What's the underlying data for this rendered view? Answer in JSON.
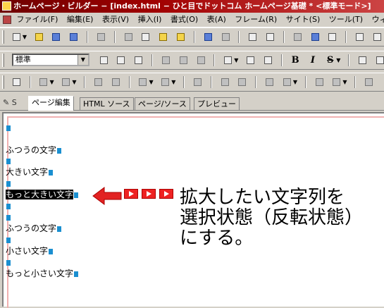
{
  "window": {
    "title": "ホームページ・ビルダー − [index.html − ひと目でドットコム ホームページ基礎 * <標準モード>]"
  },
  "menubar": {
    "items": [
      "ファイル(F)",
      "編集(E)",
      "表示(V)",
      "挿入(I)",
      "書式(O)",
      "表(A)",
      "フレーム(R)",
      "サイト(S)",
      "ツール(T)",
      "ウィ"
    ]
  },
  "format_toolbar": {
    "style_select_value": "標準",
    "bold": "B",
    "italic": "I",
    "strike": "S"
  },
  "tabs": {
    "items": [
      "ページ編集",
      "HTML ソース",
      "ページ/ソース",
      "プレビュー"
    ],
    "active": "ページ編集"
  },
  "document": {
    "lines": [
      "ふつうの文字",
      "大きい文字",
      "もっと大きい文字",
      "ふつうの文字",
      "小さい文字",
      "もっと小さい文字"
    ],
    "selected_line": "もっと大きい文字"
  },
  "annotation": {
    "text": "拡大したい文字列を\n選択状態（反転状態）\nにする。"
  },
  "colors": {
    "title_bar": "#8b0000",
    "selection_bg": "#000000",
    "paragraph_mark": "#1a8fd0",
    "arrow": "#e22222",
    "editor_border": "#f0b0b0"
  }
}
